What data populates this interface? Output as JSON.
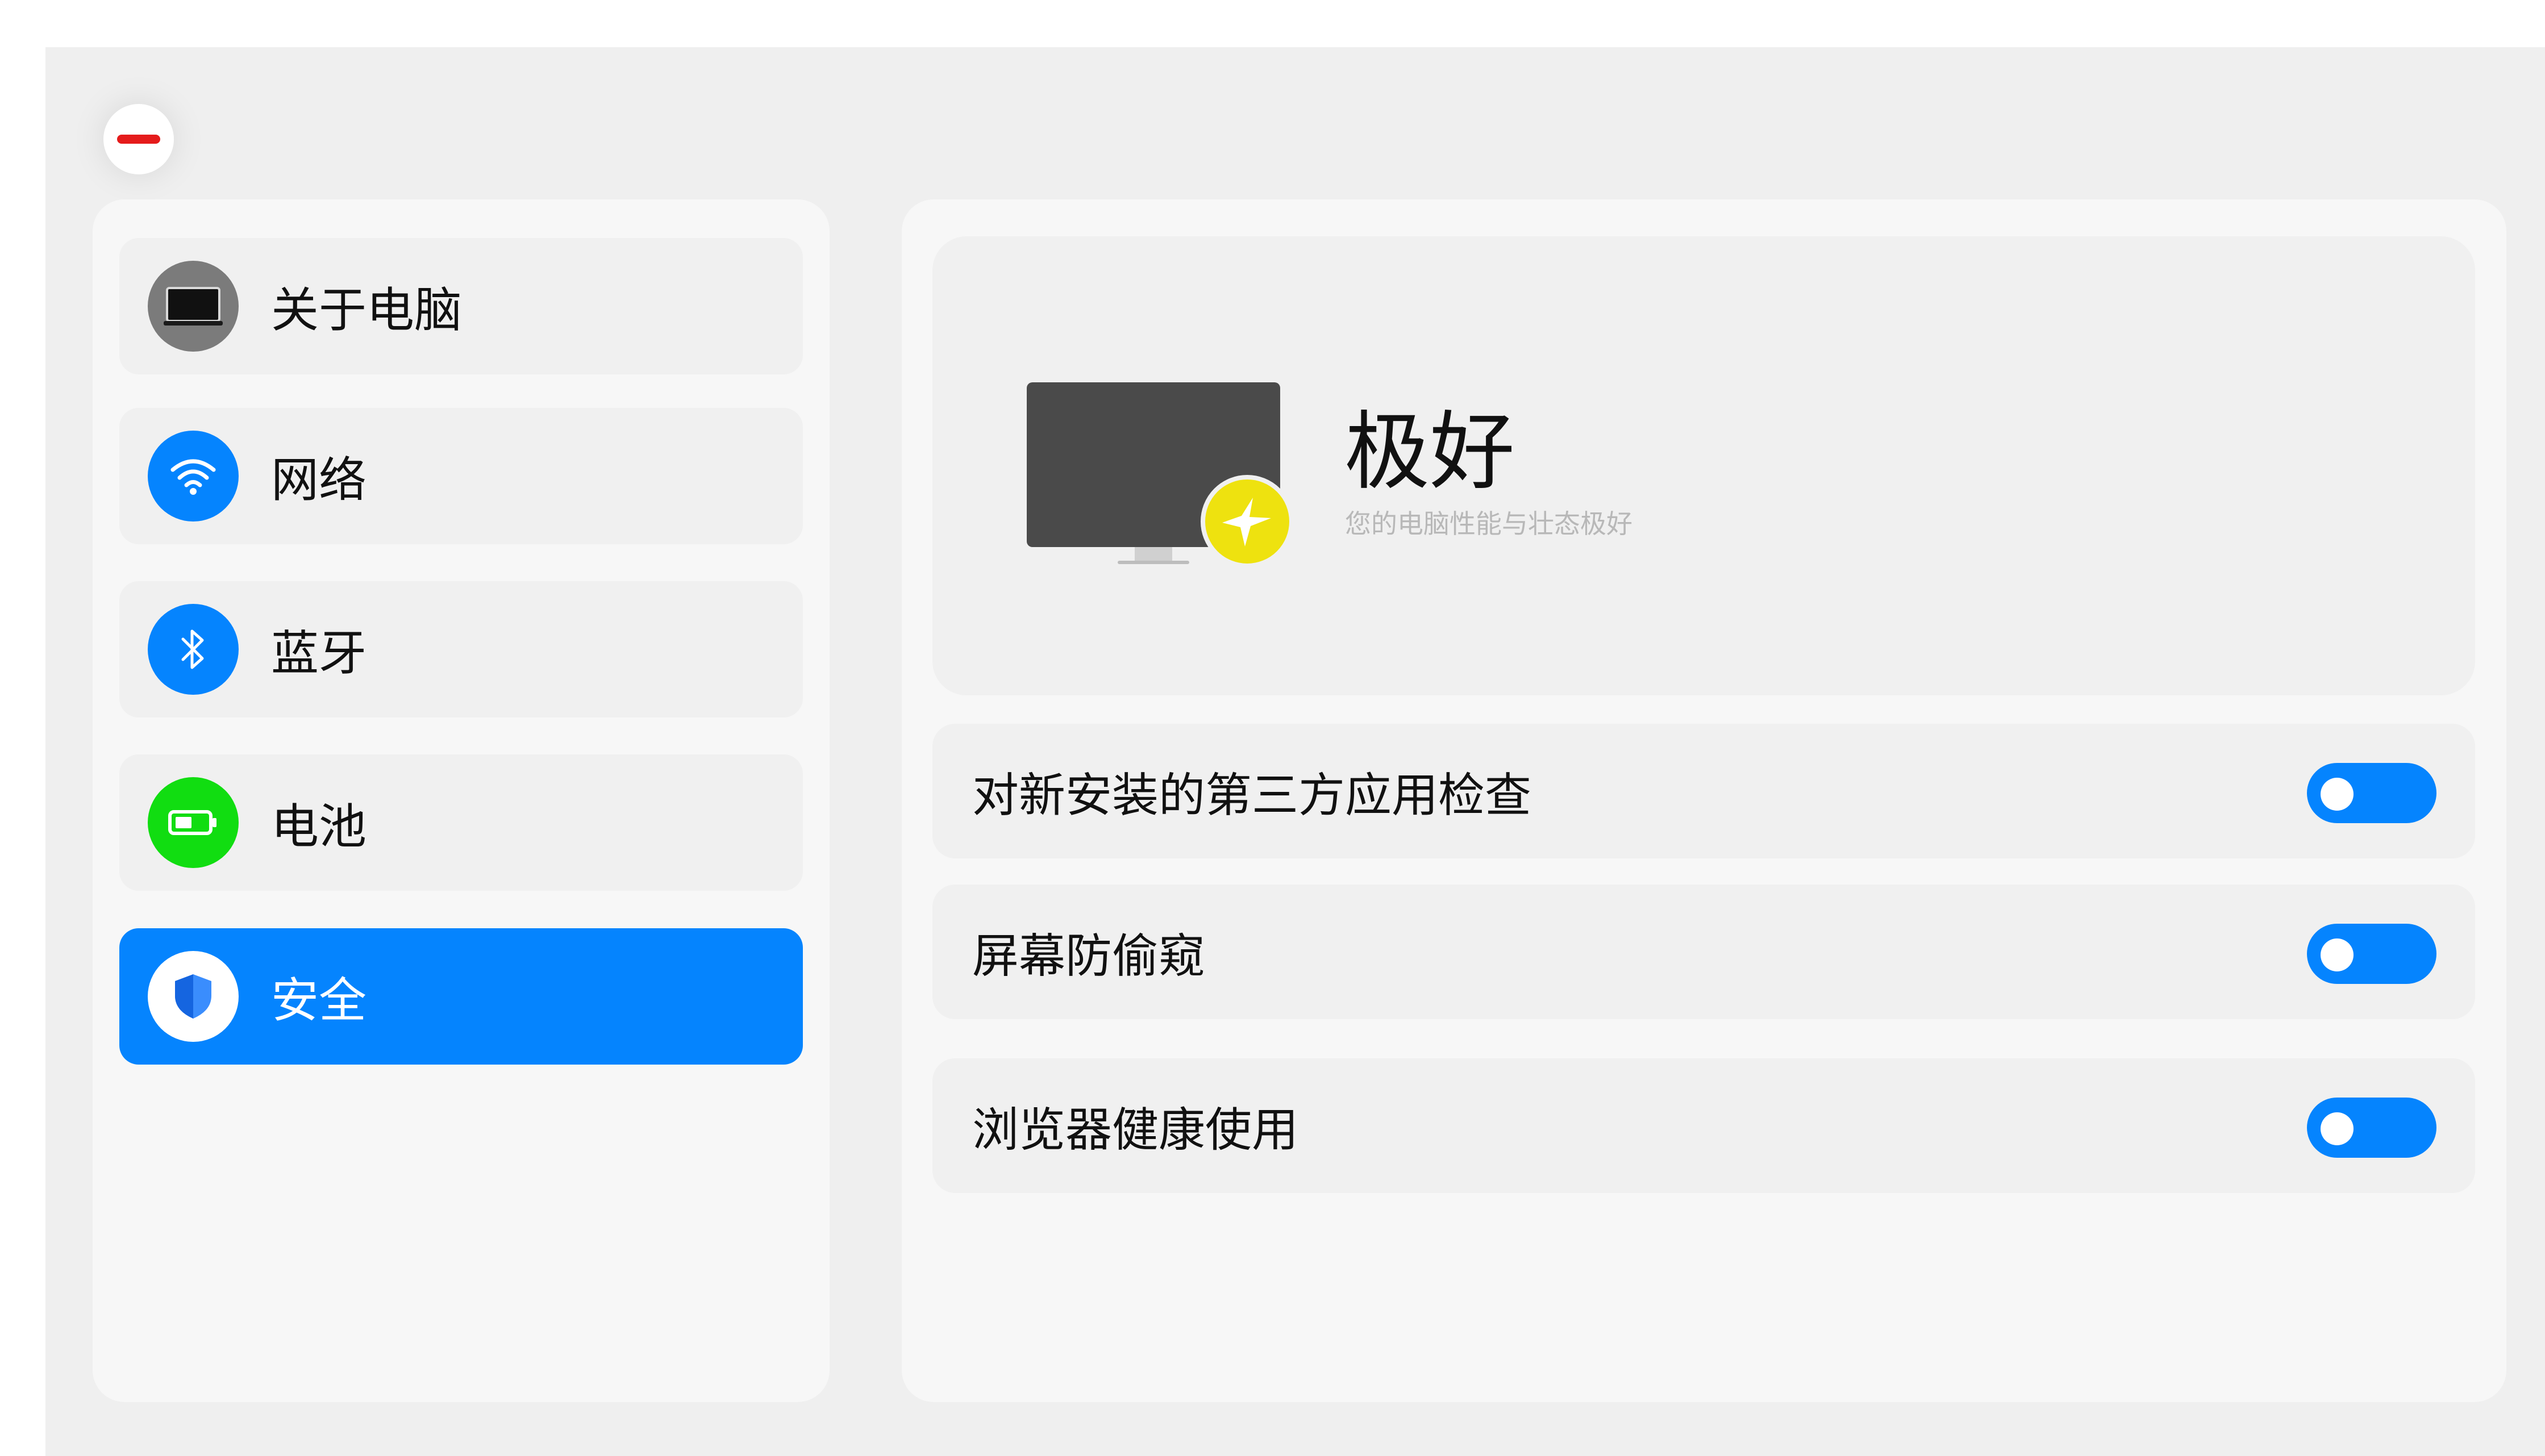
{
  "window": {
    "close_icon": "minus-icon",
    "close_color": "#e51b1b"
  },
  "sidebar": {
    "items": [
      {
        "label": "关于电脑",
        "icon": "laptop-icon",
        "icon_color": "#7b7b7b",
        "selected": false
      },
      {
        "label": "网络",
        "icon": "wifi-icon",
        "icon_color": "#0584fe",
        "selected": false
      },
      {
        "label": "蓝牙",
        "icon": "bluetooth-icon",
        "icon_color": "#0584fe",
        "selected": false
      },
      {
        "label": "电池",
        "icon": "battery-icon",
        "icon_color": "#11dd11",
        "selected": false
      },
      {
        "label": "安全",
        "icon": "shield-icon",
        "icon_color": "#ffffff",
        "selected": true
      }
    ],
    "active_color": "#0584fe"
  },
  "status": {
    "title": "极好",
    "subtitle": "您的电脑性能与壮态极好",
    "icon": "monitor-icon",
    "badge_icon": "star-icon",
    "badge_color": "#eee20f"
  },
  "settings": [
    {
      "label": "对新安装的第三方应用检查",
      "toggle_color": "#0584fe"
    },
    {
      "label": "屏幕防偷窥",
      "toggle_color": "#0584fe"
    },
    {
      "label": "浏览器健康使用",
      "toggle_color": "#0584fe"
    }
  ]
}
